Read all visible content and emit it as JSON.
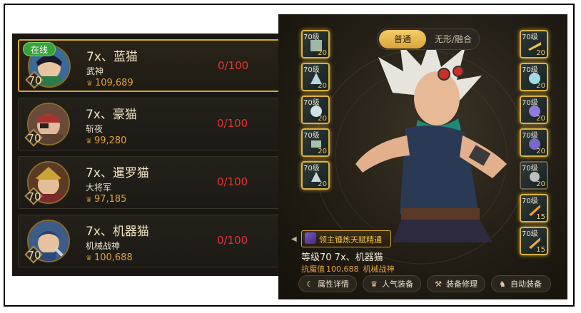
{
  "rows": [
    {
      "level": "70",
      "name": "7x、蓝猫",
      "class": "武神",
      "power": "109,689",
      "count": "0/100",
      "online": "在线",
      "selected": true
    },
    {
      "level": "70",
      "name": "7x、豪猫",
      "class": "斩夜",
      "power": "99,280",
      "count": "0/100"
    },
    {
      "level": "70",
      "name": "7x、暹罗猫",
      "class": "大将军",
      "power": "97,185",
      "count": "0/100"
    },
    {
      "level": "70",
      "name": "7x、机器猫",
      "class": "机械战神",
      "power": "100,688",
      "count": "0/100"
    }
  ],
  "tabs": {
    "normal": "普通",
    "fusion": "无形/融合"
  },
  "left_slots": [
    {
      "level": "70级",
      "value": "20"
    },
    {
      "level": "70级",
      "value": "20"
    },
    {
      "level": "70级",
      "value": "20"
    },
    {
      "level": "70级",
      "value": "20"
    },
    {
      "level": "70级",
      "value": "20"
    }
  ],
  "right_slots": [
    {
      "level": "70级",
      "value": "20"
    },
    {
      "level": "70级",
      "value": "20"
    },
    {
      "level": "70级",
      "value": "20"
    },
    {
      "level": "70级",
      "value": "20"
    },
    {
      "level": "70级",
      "value": "20"
    },
    {
      "level": "70级",
      "value": "15"
    },
    {
      "level": "70级",
      "value": "15"
    }
  ],
  "banner": "领主锤炼天赋精通",
  "character": {
    "level_line": "等级70 7x、机器猫",
    "resist_label": "抗魔值",
    "resist_value": "100,688",
    "class": "机械战神"
  },
  "buttons": {
    "attributes": "属性详情",
    "popular_gear": "人气装备",
    "repair": "装备修理",
    "auto_equip": "自动装备"
  },
  "colors": {
    "gold_border": "#d7a732",
    "count_red": "#e23636",
    "power_orange": "#e0a23c",
    "online_green": "#3aa23a"
  }
}
